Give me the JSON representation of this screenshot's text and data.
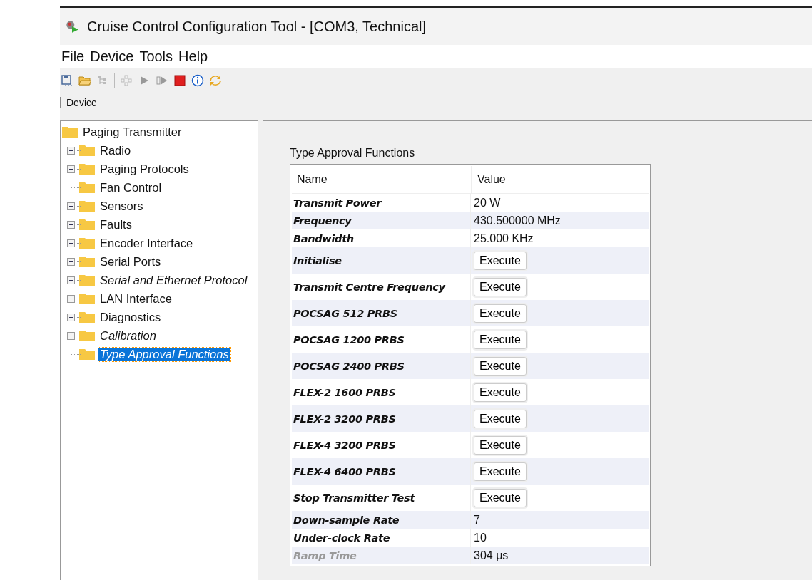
{
  "window": {
    "title": "Cruise Control Configuration Tool - [COM3, Technical]"
  },
  "menu": [
    "File",
    "Device",
    "Tools",
    "Help"
  ],
  "breadcrumb": "Device",
  "tree": {
    "label": "Paging Transmitter",
    "children": [
      {
        "label": "Radio",
        "expandable": true,
        "italic": false,
        "selected": false
      },
      {
        "label": "Paging Protocols",
        "expandable": true,
        "italic": false,
        "selected": false
      },
      {
        "label": "Fan Control",
        "expandable": false,
        "italic": false,
        "selected": false
      },
      {
        "label": "Sensors",
        "expandable": true,
        "italic": false,
        "selected": false
      },
      {
        "label": "Faults",
        "expandable": true,
        "italic": false,
        "selected": false
      },
      {
        "label": "Encoder Interface",
        "expandable": true,
        "italic": false,
        "selected": false
      },
      {
        "label": "Serial Ports",
        "expandable": true,
        "italic": false,
        "selected": false
      },
      {
        "label": "Serial and Ethernet Protocol",
        "expandable": true,
        "italic": true,
        "selected": false
      },
      {
        "label": "LAN Interface",
        "expandable": true,
        "italic": false,
        "selected": false
      },
      {
        "label": "Diagnostics",
        "expandable": true,
        "italic": false,
        "selected": false
      },
      {
        "label": "Calibration",
        "expandable": true,
        "italic": true,
        "selected": false
      },
      {
        "label": "Type Approval Functions",
        "expandable": false,
        "italic": true,
        "selected": true
      }
    ]
  },
  "panel": {
    "title": "Type Approval Functions",
    "table": {
      "columns": [
        "Name",
        "Value"
      ],
      "rows": [
        {
          "kind": "value",
          "name": "Transmit Power",
          "value": "20 W",
          "disabled": false
        },
        {
          "kind": "value",
          "name": "Frequency",
          "value": "430.500000 MHz",
          "disabled": false
        },
        {
          "kind": "value",
          "name": "Bandwidth",
          "value": "25.000 KHz",
          "disabled": false
        },
        {
          "kind": "action",
          "name": "Initialise",
          "value": "Execute",
          "disabled": false
        },
        {
          "kind": "action",
          "name": "Transmit Centre Frequency",
          "value": "Execute",
          "disabled": false
        },
        {
          "kind": "action",
          "name": "POCSAG 512 PRBS",
          "value": "Execute",
          "disabled": false
        },
        {
          "kind": "action",
          "name": "POCSAG 1200 PRBS",
          "value": "Execute",
          "disabled": false
        },
        {
          "kind": "action",
          "name": "POCSAG 2400 PRBS",
          "value": "Execute",
          "disabled": false
        },
        {
          "kind": "action",
          "name": "FLEX-2 1600 PRBS",
          "value": "Execute",
          "disabled": false
        },
        {
          "kind": "action",
          "name": "FLEX-2 3200 PRBS",
          "value": "Execute",
          "disabled": false
        },
        {
          "kind": "action",
          "name": "FLEX-4 3200 PRBS",
          "value": "Execute",
          "disabled": false
        },
        {
          "kind": "action",
          "name": "FLEX-4 6400 PRBS",
          "value": "Execute",
          "disabled": false
        },
        {
          "kind": "action",
          "name": "Stop Transmitter Test",
          "value": "Execute",
          "disabled": false
        },
        {
          "kind": "value",
          "name": "Down-sample Rate",
          "value": "7",
          "disabled": false
        },
        {
          "kind": "value",
          "name": "Under-clock Rate",
          "value": "10",
          "disabled": false
        },
        {
          "kind": "value",
          "name": "Ramp Time",
          "value": "304 μs",
          "disabled": true
        }
      ]
    }
  }
}
